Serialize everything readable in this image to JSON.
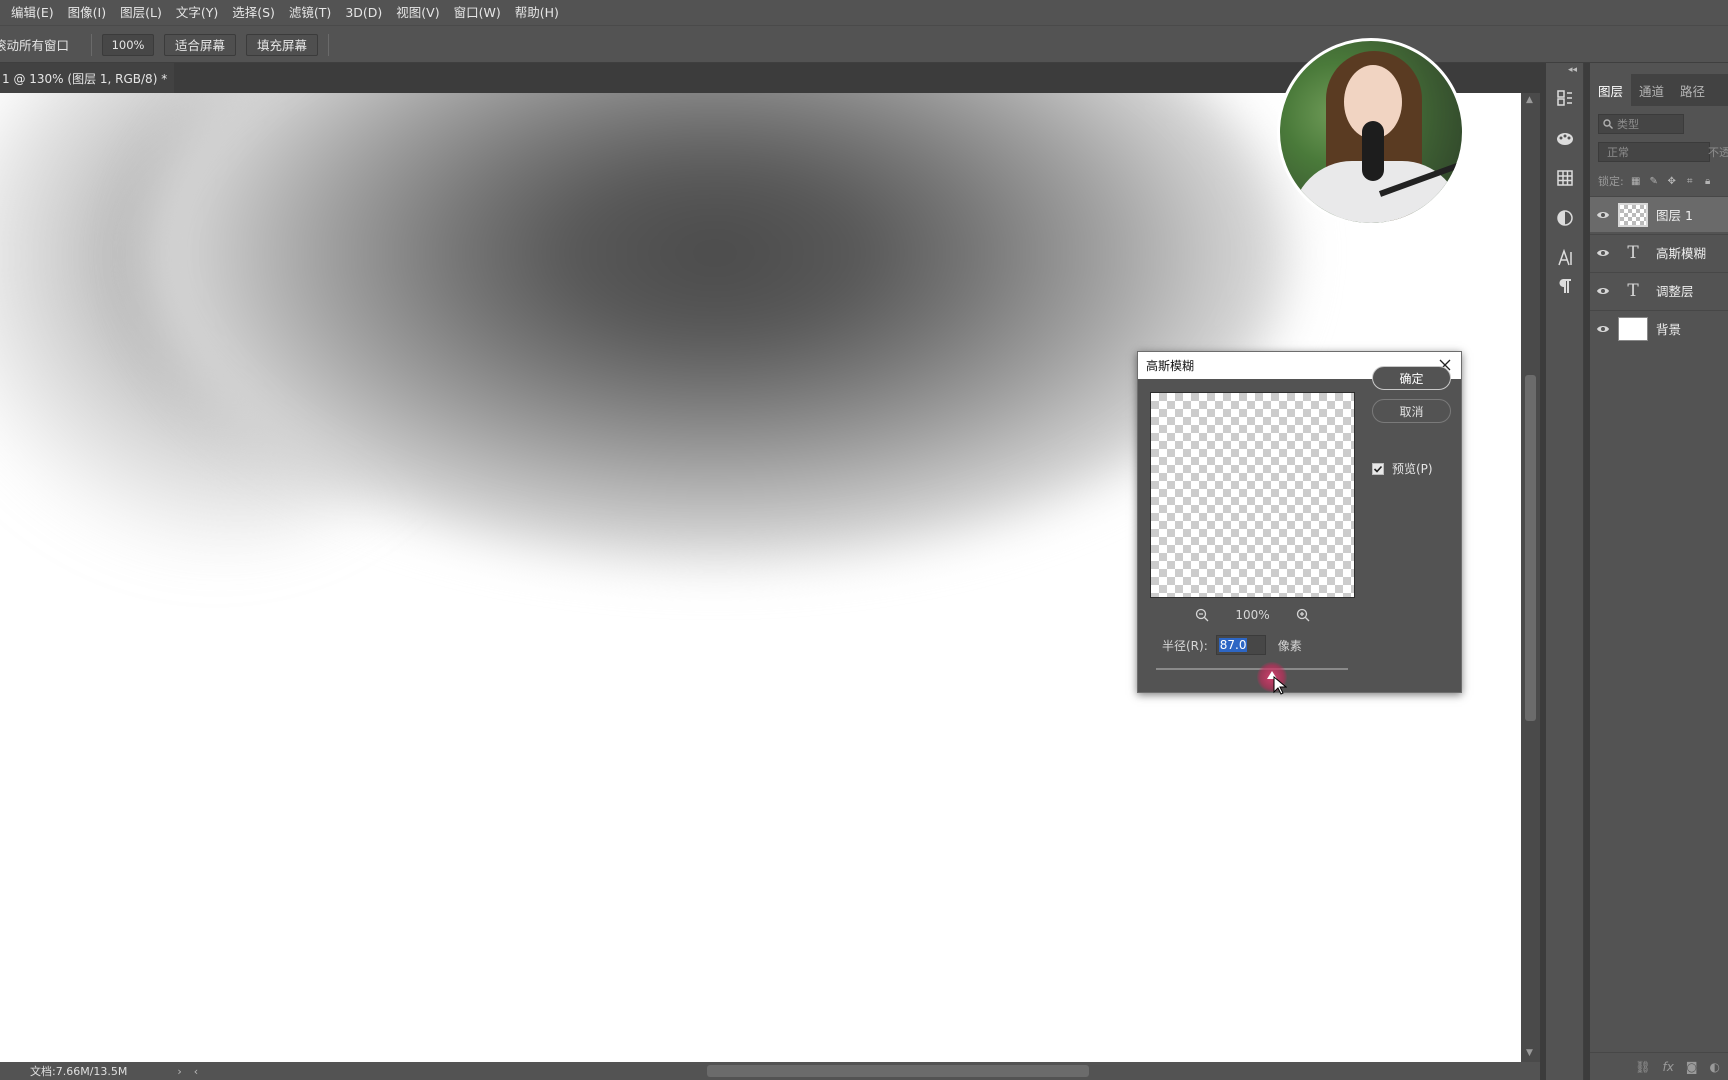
{
  "menubar": {
    "items": [
      "编辑(E)",
      "图像(I)",
      "图层(L)",
      "文字(Y)",
      "选择(S)",
      "滤镜(T)",
      "3D(D)",
      "视图(V)",
      "窗口(W)",
      "帮助(H)"
    ]
  },
  "options": {
    "scroll_all_label": "滚动所有窗口",
    "zoom_value": "100%",
    "fit_screen": "适合屏幕",
    "fill_screen": "填充屏幕"
  },
  "document": {
    "tab_title": "1 @ 130% (图层 1, RGB/8) *",
    "close_glyph": "×"
  },
  "status": {
    "doc_size": "文档:7.66M/13.5M",
    "arrow_right": "›",
    "arrow_left": "‹"
  },
  "layers_panel": {
    "tabs": [
      "图层",
      "通道",
      "路径"
    ],
    "search_placeholder": "类型",
    "blend_mode": "正常",
    "opacity_label": "不透",
    "lock_label": "锁定:",
    "layers": [
      {
        "name": "图层 1",
        "kind": "pixel",
        "selected": true
      },
      {
        "name": "高斯模糊",
        "kind": "text",
        "selected": false
      },
      {
        "name": "调整层",
        "kind": "text",
        "selected": false
      },
      {
        "name": "背景",
        "kind": "background",
        "selected": false
      }
    ],
    "text_glyph": "T",
    "fx_label": "fx"
  },
  "dialog": {
    "title": "高斯模糊",
    "ok_label": "确定",
    "cancel_label": "取消",
    "preview_label": "预览(P)",
    "preview_checked": true,
    "zoom_level": "100%",
    "radius_label": "半径(R):",
    "radius_value": "87.0",
    "radius_unit": "像素"
  },
  "icons": {
    "toolstrip": [
      "history-icon",
      "color-icon",
      "swatches-icon",
      "adjustments-icon",
      "character-icon",
      "paragraph-icon"
    ]
  }
}
